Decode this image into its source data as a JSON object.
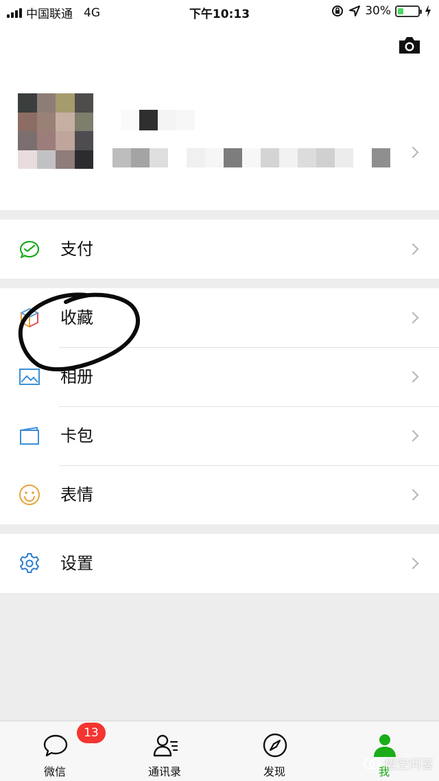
{
  "status_bar": {
    "carrier": "中国联通",
    "network": "4G",
    "time": "下午10:13",
    "battery": "30%",
    "battery_level": 0.3
  },
  "profile": {
    "camera_icon": "camera-icon",
    "chevron_icon": "chevron-right-icon"
  },
  "groups": {
    "pay": {
      "label": "支付",
      "icon": "wechat-pay-icon"
    },
    "main": [
      {
        "label": "收藏",
        "icon": "favorites-cube-icon"
      },
      {
        "label": "相册",
        "icon": "album-icon"
      },
      {
        "label": "卡包",
        "icon": "card-wallet-icon"
      },
      {
        "label": "表情",
        "icon": "smiley-icon"
      }
    ],
    "settings": {
      "label": "设置",
      "icon": "gear-icon"
    }
  },
  "tabbar": {
    "tabs": [
      {
        "label": "微信",
        "icon": "chat-icon",
        "badge": "13"
      },
      {
        "label": "通讯录",
        "icon": "contacts-icon"
      },
      {
        "label": "发现",
        "icon": "compass-icon"
      },
      {
        "label": "我",
        "icon": "me-icon",
        "active": true
      }
    ]
  },
  "watermark": "悟空问答",
  "colors": {
    "wechat_green": "#1aad19",
    "badge_red": "#f43530",
    "settings_blue": "#2e7dd1",
    "smiley_orange": "#e8a23a"
  }
}
